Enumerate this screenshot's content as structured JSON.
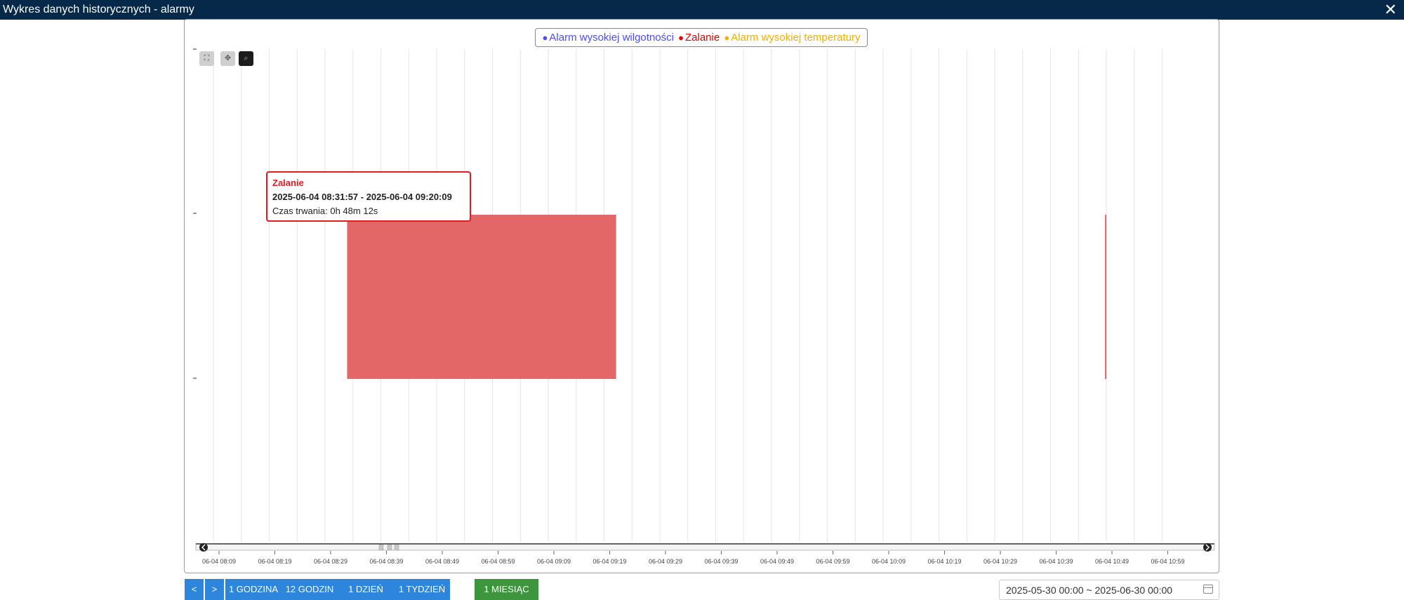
{
  "window": {
    "title": "Wykres danych historycznych - alarmy",
    "close_icon": "close-icon"
  },
  "legend": {
    "items": [
      {
        "label": "Alarm wysokiej wilgotności",
        "color": "#4d4df5"
      },
      {
        "label": "Zalanie",
        "color": "#e60000"
      },
      {
        "label": "Alarm wysokiej temperatury",
        "color": "#f0b000"
      }
    ]
  },
  "toolbox": {
    "items": [
      "fullscreen-icon",
      "pan-icon",
      "zoom-icon"
    ],
    "active": "zoom-icon"
  },
  "tooltip": {
    "series": "Zalanie",
    "range": "2025-06-04 08:31:57 - 2025-06-04 09:20:09",
    "duration": "Czas trwania: 0h 48m 12s"
  },
  "chart_data": {
    "type": "bar",
    "x_axis_format": "MM-DD HH:mm",
    "x_ticks": [
      "06-04 08:09",
      "06-04 08:19",
      "06-04 08:29",
      "06-04 08:39",
      "06-04 08:49",
      "06-04 08:59",
      "06-04 09:09",
      "06-04 09:19",
      "06-04 09:29",
      "06-04 09:39",
      "06-04 09:49",
      "06-04 09:59",
      "06-04 10:09",
      "06-04 10:19",
      "06-04 10:29",
      "06-04 10:39",
      "06-04 10:49",
      "06-04 10:59"
    ],
    "xlim": [
      "2025-06-04 08:03",
      "2025-06-04 11:02"
    ],
    "grid": true,
    "legend_position": "top-center",
    "series": [
      {
        "name": "Alarm wysokiej wilgotności",
        "color": "#4d4df5",
        "intervals": []
      },
      {
        "name": "Zalanie",
        "color": "#e46767",
        "intervals": [
          {
            "start": "2025-06-04 08:31:57",
            "end": "2025-06-04 09:20:09"
          },
          {
            "start": "2025-06-04 10:47:45",
            "end": "2025-06-04 10:48:00"
          }
        ]
      },
      {
        "name": "Alarm wysokiej temperatury",
        "color": "#f0b000",
        "intervals": []
      }
    ]
  },
  "range_buttons": {
    "prev": "<",
    "next": ">",
    "items": [
      "1 GODZINA",
      "12 GODZIN",
      "1 DZIEŃ",
      "1 TYDZIEŃ",
      "1 MIESIĄC"
    ],
    "active": "1 MIESIĄC"
  },
  "date_range": {
    "value": "2025-05-30 00:00 ~ 2025-06-30 00:00",
    "icon": "calendar-icon"
  }
}
